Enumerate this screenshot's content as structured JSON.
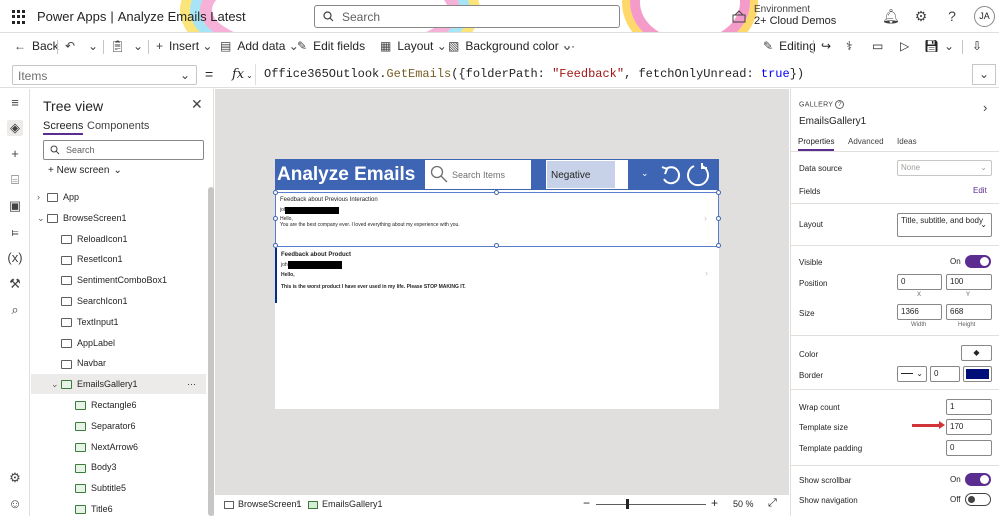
{
  "app": {
    "product": "Power Apps",
    "separator": "|",
    "title": "Analyze Emails Latest"
  },
  "search": {
    "placeholder": "Search"
  },
  "environment": {
    "label": "Environment",
    "name": "2+ Cloud Demos"
  },
  "user": {
    "initials": "JA"
  },
  "commands": {
    "back": "Back",
    "insert": "Insert",
    "add_data": "Add data",
    "edit_fields": "Edit fields",
    "layout": "Layout",
    "background_color": "Background color",
    "more": "···",
    "editing": "Editing"
  },
  "formula_bar": {
    "property": "Items",
    "equals": "=",
    "fx": "fx",
    "formula_parts": [
      "Office365Outlook.",
      "GetEmails",
      "({folderPath: ",
      "\"Feedback\"",
      ", fetchOnlyUnread: ",
      "true",
      "})"
    ]
  },
  "tree": {
    "title": "Tree view",
    "tabs": [
      "Screens",
      "Components"
    ],
    "search_placeholder": "Search",
    "new_screen": "New screen",
    "items": [
      {
        "label": "App",
        "indent": 0,
        "selected": false
      },
      {
        "label": "BrowseScreen1",
        "indent": 0,
        "selected": false
      },
      {
        "label": "ReloadIcon1",
        "indent": 1,
        "selected": false
      },
      {
        "label": "ResetIcon1",
        "indent": 1,
        "selected": false
      },
      {
        "label": "SentimentComboBox1",
        "indent": 1,
        "selected": false
      },
      {
        "label": "SearchIcon1",
        "indent": 1,
        "selected": false
      },
      {
        "label": "TextInput1",
        "indent": 1,
        "selected": false
      },
      {
        "label": "AppLabel",
        "indent": 1,
        "selected": false
      },
      {
        "label": "Navbar",
        "indent": 1,
        "selected": false
      },
      {
        "label": "EmailsGallery1",
        "indent": 1,
        "selected": true,
        "more": "···"
      },
      {
        "label": "Rectangle6",
        "indent": 2,
        "selected": false
      },
      {
        "label": "Separator6",
        "indent": 2,
        "selected": false
      },
      {
        "label": "NextArrow6",
        "indent": 2,
        "selected": false
      },
      {
        "label": "Body3",
        "indent": 2,
        "selected": false
      },
      {
        "label": "Subtitle5",
        "indent": 2,
        "selected": false
      },
      {
        "label": "Title6",
        "indent": 2,
        "selected": false
      }
    ]
  },
  "canvas": {
    "app_title": "Analyze Emails",
    "search_placeholder": "Search Items",
    "combo_value": "Negative",
    "rows": [
      {
        "title": "Feedback about Previous Interaction",
        "name_prefix": "joh",
        "greeting": "Hello,",
        "body": "You are the best company ever. I loved everything about my experience with you."
      },
      {
        "title": "Feedback about Product",
        "name_prefix": "joh",
        "greeting": "Hello,",
        "body": "This is the worst product I have ever used in my life. Please STOP MAKING IT."
      }
    ]
  },
  "status": {
    "screen": "BrowseScreen1",
    "control": "EmailsGallery1",
    "zoom_minus": "−",
    "zoom_plus": "+",
    "zoom": "50",
    "zoom_unit": "%"
  },
  "properties": {
    "type": "GALLERY",
    "name": "EmailsGallery1",
    "tabs": [
      "Properties",
      "Advanced",
      "Ideas"
    ],
    "data_source_label": "Data source",
    "data_source_value": "None",
    "fields_label": "Fields",
    "fields_edit": "Edit",
    "layout_label": "Layout",
    "layout_value": "Title, subtitle, and body",
    "visible_label": "Visible",
    "visible_value": "On",
    "position_label": "Position",
    "position_x": "0",
    "position_y": "100",
    "x_label": "X",
    "y_label": "Y",
    "size_label": "Size",
    "width": "1366",
    "height": "668",
    "width_label": "Width",
    "height_label": "Height",
    "color_label": "Color",
    "border_label": "Border",
    "border_width": "0",
    "border_color": "#000f78",
    "wrap_count_label": "Wrap count",
    "wrap_count": "1",
    "template_size_label": "Template size",
    "template_size": "170",
    "template_padding_label": "Template padding",
    "template_padding": "0",
    "show_scrollbar_label": "Show scrollbar",
    "show_scrollbar_value": "On",
    "show_navigation_label": "Show navigation",
    "show_navigation_value": "Off"
  },
  "colors": {
    "navbar": "#3e64b4",
    "accent": "#5c2d91",
    "annotation_arrow": "#d13438"
  }
}
